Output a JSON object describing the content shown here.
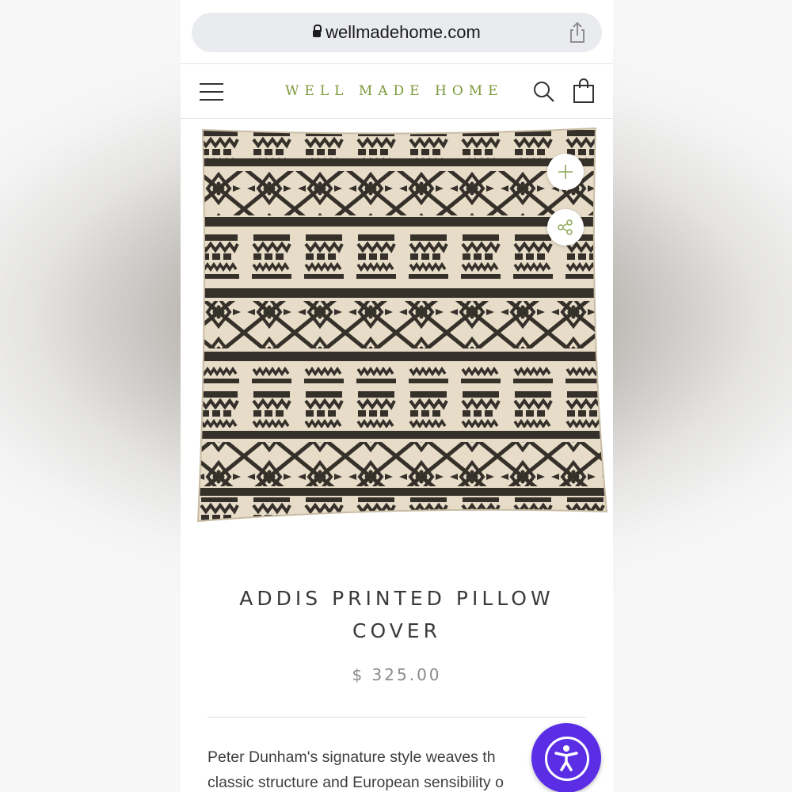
{
  "browser": {
    "url": "wellmadehome.com"
  },
  "header": {
    "brand": "WELL MADE HOME"
  },
  "product": {
    "title": "ADDIS PRINTED PILLOW COVER",
    "price": "$ 325.00",
    "description_lines": [
      "Peter Dunham's signature style weaves th",
      "classic structure and European sensibility o"
    ]
  },
  "icons": {
    "lock": "lock-icon",
    "share": "share-icon",
    "menu": "hamburger-menu-icon",
    "search": "search-icon",
    "cart": "shopping-bag-icon",
    "zoom": "plus-icon",
    "product_share": "share-nodes-icon",
    "accessibility": "accessibility-icon"
  },
  "colors": {
    "brand": "#7d9a3c",
    "accessibility": "#5b2ee6",
    "pattern_ink": "#35302a",
    "pillow_base": "#e6dcc8"
  }
}
